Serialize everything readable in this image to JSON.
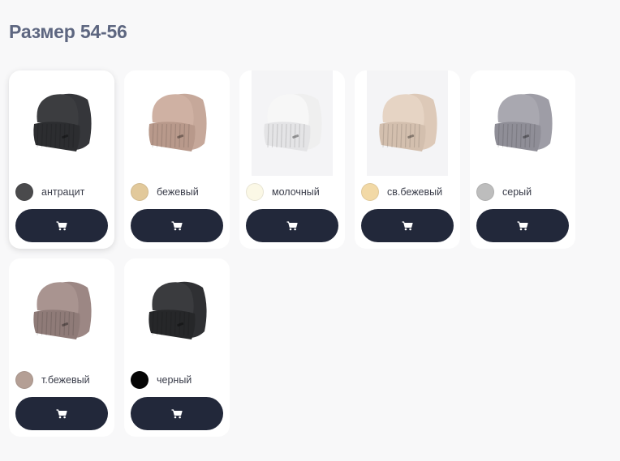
{
  "section": {
    "title": "Размер 54-56"
  },
  "products": [
    {
      "color_name": "антрацит",
      "swatch": "#4a4a4c",
      "hat": "#3c3d40",
      "hat_shade": "#2c2d30",
      "scarf": "#35363a",
      "style": "set-dark",
      "active": true,
      "icon": "cart-icon"
    },
    {
      "color_name": "бежевый",
      "swatch": "#e2c99b",
      "hat": "#cfb1a3",
      "hat_shade": "#b8998b",
      "scarf": "#c6a89a",
      "style": "set",
      "active": false,
      "icon": "cart-icon"
    },
    {
      "color_name": "молочный",
      "swatch": "#fbf8e6",
      "hat": "#f7f7f7",
      "hat_shade": "#e4e4e6",
      "scarf": "#efefef",
      "style": "set-framed",
      "active": false,
      "icon": "cart-icon"
    },
    {
      "color_name": "св.бежевый",
      "swatch": "#f2d9a6",
      "hat": "#e6d4c4",
      "hat_shade": "#d3bfae",
      "scarf": "#ddc9b8",
      "style": "set-framed",
      "active": false,
      "icon": "cart-icon"
    },
    {
      "color_name": "серый",
      "swatch": "#bdbdbd",
      "hat": "#a9a8b0",
      "hat_shade": "#8f8e97",
      "scarf": "#9e9da6",
      "style": "set",
      "active": false,
      "icon": "cart-icon"
    },
    {
      "color_name": "т.бежевый",
      "swatch": "#b49f95",
      "hat": "#a99490",
      "hat_shade": "#8f7b78",
      "scarf": "#9c8784",
      "style": "set",
      "active": false,
      "icon": "cart-icon"
    },
    {
      "color_name": "черный",
      "swatch": "#050505",
      "hat": "#3a3b3e",
      "hat_shade": "#262729",
      "scarf": "#2f3033",
      "style": "set-dark",
      "active": false,
      "icon": "cart-icon"
    }
  ],
  "button_color": "#22283a"
}
